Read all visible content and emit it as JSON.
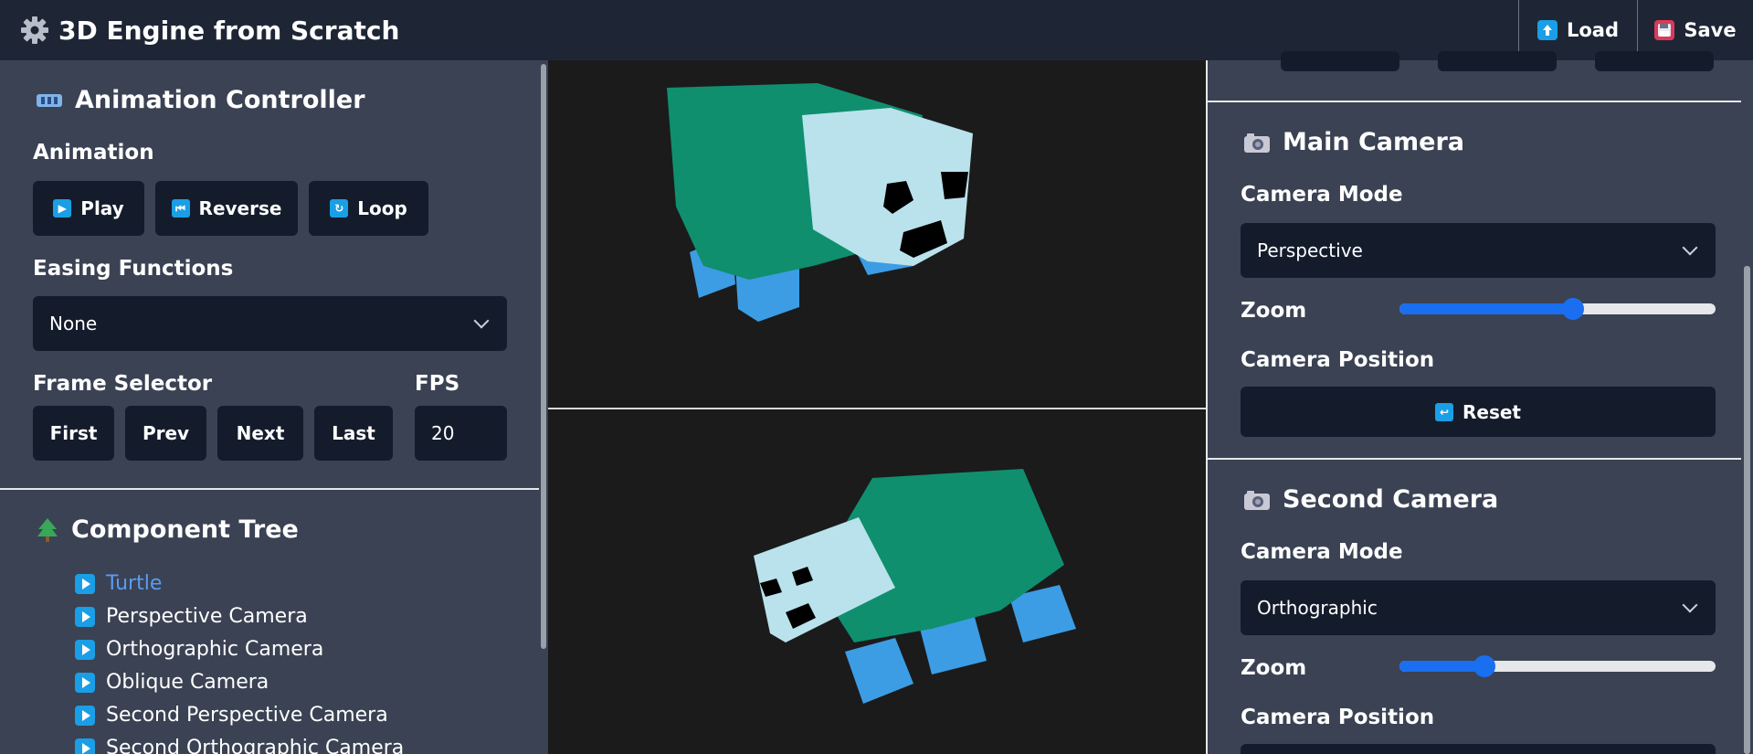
{
  "app": {
    "title": "3D Engine from Scratch",
    "load_label": "Load",
    "save_label": "Save"
  },
  "animation_controller": {
    "title": "Animation Controller",
    "animation_label": "Animation",
    "play_label": "Play",
    "reverse_label": "Reverse",
    "loop_label": "Loop",
    "easing_label": "Easing Functions",
    "easing_value": "None",
    "frame_selector_label": "Frame Selector",
    "first_label": "First",
    "prev_label": "Prev",
    "next_label": "Next",
    "last_label": "Last",
    "fps_label": "FPS",
    "fps_value": "20"
  },
  "component_tree": {
    "title": "Component Tree",
    "items": [
      "Turtle",
      "Perspective Camera",
      "Orthographic Camera",
      "Oblique Camera",
      "Second Perspective Camera",
      "Second Orthographic Camera"
    ],
    "active_index": 0
  },
  "main_camera": {
    "title": "Main Camera",
    "mode_label": "Camera Mode",
    "mode_value": "Perspective",
    "zoom_label": "Zoom",
    "zoom_level": 0.55,
    "position_label": "Camera Position",
    "reset_label": "Reset"
  },
  "second_camera": {
    "title": "Second Camera",
    "mode_label": "Camera Mode",
    "mode_value": "Orthographic",
    "zoom_label": "Zoom",
    "zoom_level": 0.27,
    "position_label": "Camera Position"
  },
  "colors": {
    "shell_green": "#0f8f6e",
    "head": "#b9e2ec",
    "legs": "#3c9de5",
    "accent": "#1a6ef0",
    "icon_blue": "#1a9ee6"
  },
  "icons": {
    "app": "gear-icon",
    "load": "upload-icon",
    "save": "floppy-disk-icon",
    "animation": "film-icon",
    "tree": "tree-icon",
    "camera": "camera-icon"
  }
}
